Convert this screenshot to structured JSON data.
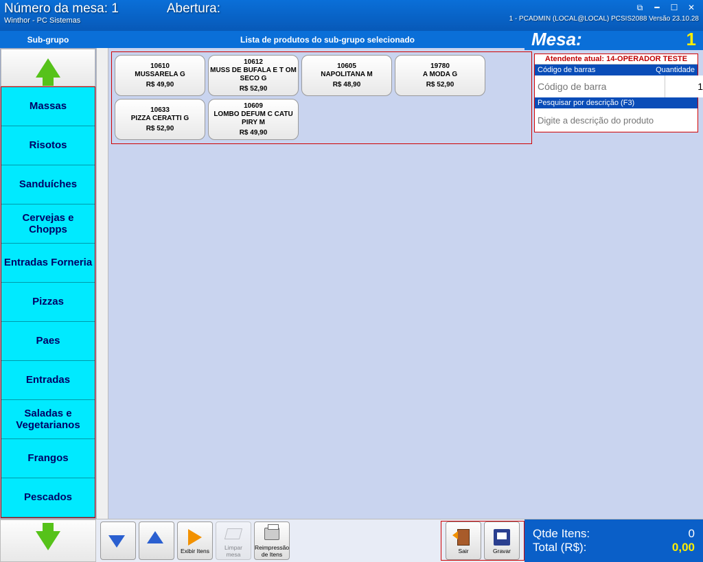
{
  "titlebar": {
    "line1_left": "Número da mesa: 1",
    "line1_center": "Abertura:",
    "line2": "Winthor - PC Sistemas",
    "status": "1 - PCADMIN (LOCAL@LOCAL)   PCSIS2088   Versão 23.10.28"
  },
  "header_strip": {
    "sub_grupo": "Sub-grupo",
    "lista": "Lista de produtos do sub-grupo selecionado",
    "mesa_label": "Mesa:",
    "mesa_num": "1"
  },
  "categories": [
    "Massas",
    "Risotos",
    "Sanduíches",
    "Cervejas e Chopps",
    "Entradas Forneria",
    "Pizzas",
    "Paes",
    "Entradas",
    "Saladas e Vegetarianos",
    "Frangos",
    "Pescados"
  ],
  "products": [
    {
      "code": "10610",
      "name": "MUSSARELA G",
      "price": "R$ 49,90"
    },
    {
      "code": "10612",
      "name": "MUSS DE BUFALA E T OM SECO G",
      "price": "R$ 52,90"
    },
    {
      "code": "10605",
      "name": "NAPOLITANA M",
      "price": "R$ 48,90"
    },
    {
      "code": "19780",
      "name": "A MODA G",
      "price": "R$ 52,90"
    },
    {
      "code": "10633",
      "name": "PIZZA CERATTI G",
      "price": "R$ 52,90"
    },
    {
      "code": "10609",
      "name": "LOMBO DEFUM C CATU PIRY M",
      "price": "R$ 49,90"
    }
  ],
  "right_panel": {
    "atendente": "Atendente atual: 14-OPERADOR TESTE",
    "barcode_header": "Código de barras",
    "qty_header": "Quantidade",
    "barcode_placeholder": "Código de barra",
    "qty_value": "1",
    "search_header": "Pesquisar por descrição (F3)",
    "search_placeholder": "Digite a descrição do produto"
  },
  "bottom": {
    "exibir": "Exibir Itens",
    "limpar": "Limpar mesa",
    "reimpressao": "Reimpressão de Itens",
    "sair": "Sair",
    "gravar": "Gravar",
    "qtde_label": "Qtde Itens:",
    "qtde_value": "0",
    "total_label": "Total (R$):",
    "total_value": "0,00"
  }
}
